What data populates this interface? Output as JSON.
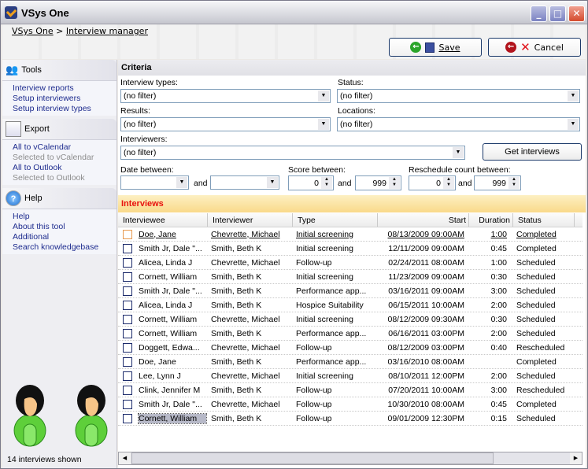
{
  "window": {
    "title": "VSys One",
    "min_label": "_",
    "max_label": "□",
    "close_label": "✕"
  },
  "breadcrumb": {
    "root": "VSys One",
    "sep": ">",
    "current": "Interview manager"
  },
  "toolbar": {
    "save_label": "Save",
    "cancel_label": "Cancel"
  },
  "sidebar": {
    "tools": {
      "title": "Tools",
      "items": [
        {
          "label": "Interview reports",
          "enabled": true
        },
        {
          "label": "Setup interviewers",
          "enabled": true
        },
        {
          "label": "Setup interview types",
          "enabled": true
        }
      ]
    },
    "export": {
      "title": "Export",
      "items": [
        {
          "label": "All to vCalendar",
          "enabled": true
        },
        {
          "label": "Selected to vCalendar",
          "enabled": false
        },
        {
          "label": "All to Outlook",
          "enabled": true
        },
        {
          "label": "Selected to Outlook",
          "enabled": false
        }
      ]
    },
    "help": {
      "title": "Help",
      "items": [
        {
          "label": "Help",
          "enabled": true
        },
        {
          "label": "About this tool",
          "enabled": true
        },
        {
          "label": "Additional",
          "enabled": true
        },
        {
          "label": "Search knowledgebase",
          "enabled": true
        }
      ]
    },
    "status": "14 interviews shown"
  },
  "criteria": {
    "title": "Criteria",
    "interview_types": {
      "label": "Interview types:",
      "value": "(no filter)"
    },
    "status": {
      "label": "Status:",
      "value": "(no filter)"
    },
    "results": {
      "label": "Results:",
      "value": "(no filter)"
    },
    "locations": {
      "label": "Locations:",
      "value": "(no filter)"
    },
    "interviewers": {
      "label": "Interviewers:",
      "value": "(no filter)"
    },
    "get_button": "Get interviews",
    "date": {
      "label": "Date between:",
      "from": "",
      "and": "and",
      "to": ""
    },
    "score": {
      "label": "Score between:",
      "from": "0",
      "and": "and",
      "to": "999"
    },
    "reschedule": {
      "label": "Reschedule count between:",
      "from": "0",
      "and": "and",
      "to": "999"
    }
  },
  "interviews": {
    "title": "Interviews",
    "columns": [
      "Interviewee",
      "Interviewer",
      "Type",
      "Start",
      "Duration",
      "Status"
    ],
    "rows": [
      [
        "Doe, Jane",
        "Chevrette, Michael",
        "Initial screening",
        "08/13/2009 09:00AM",
        "1:00",
        "Completed"
      ],
      [
        "Smith Jr, Dale \"...",
        "Smith, Beth K",
        "Initial screening",
        "12/11/2009 09:00AM",
        "0:45",
        "Completed"
      ],
      [
        "Alicea, Linda J",
        "Chevrette, Michael",
        "Follow-up",
        "02/24/2011 08:00AM",
        "1:00",
        "Scheduled"
      ],
      [
        "Cornett, William",
        "Smith, Beth K",
        "Initial screening",
        "11/23/2009 09:00AM",
        "0:30",
        "Scheduled"
      ],
      [
        "Smith Jr, Dale \"...",
        "Smith, Beth K",
        "Performance app...",
        "03/16/2011 09:00AM",
        "3:00",
        "Scheduled"
      ],
      [
        "Alicea, Linda J",
        "Smith, Beth K",
        "Hospice Suitability",
        "06/15/2011 10:00AM",
        "2:00",
        "Scheduled"
      ],
      [
        "Cornett, William",
        "Chevrette, Michael",
        "Initial screening",
        "08/12/2009 09:30AM",
        "0:30",
        "Scheduled"
      ],
      [
        "Cornett, William",
        "Smith, Beth K",
        "Performance app...",
        "06/16/2011 03:00PM",
        "2:00",
        "Scheduled"
      ],
      [
        "Doggett, Edwa...",
        "Chevrette, Michael",
        "Follow-up",
        "08/12/2009 03:00PM",
        "0:40",
        "Rescheduled"
      ],
      [
        "Doe, Jane",
        "Smith, Beth K",
        "Performance app...",
        "03/16/2010 08:00AM",
        "",
        "Completed"
      ],
      [
        "Lee, Lynn J",
        "Chevrette, Michael",
        "Initial screening",
        "08/10/2011 12:00PM",
        "2:00",
        "Scheduled"
      ],
      [
        "Clink, Jennifer M",
        "Smith, Beth K",
        "Follow-up",
        "07/20/2011 10:00AM",
        "3:00",
        "Rescheduled"
      ],
      [
        "Smith Jr, Dale \"...",
        "Chevrette, Michael",
        "Follow-up",
        "10/30/2010 08:00AM",
        "0:45",
        "Completed"
      ],
      [
        "Cornett, William",
        "Smith, Beth K",
        "Follow-up",
        "09/01/2009 12:30PM",
        "0:15",
        "Scheduled"
      ]
    ],
    "hover_row": 0,
    "selected_row": 13
  }
}
